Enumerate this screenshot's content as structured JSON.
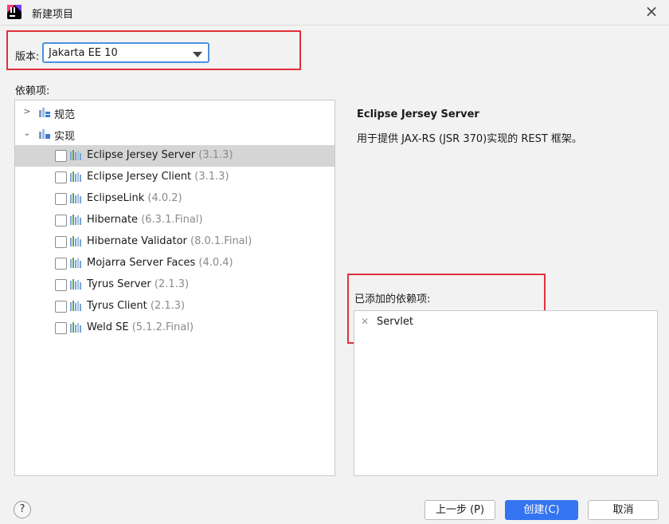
{
  "window": {
    "title": "新建项目",
    "close_icon": "close-icon"
  },
  "version": {
    "label": "版本:",
    "selected": "Jakarta EE 10"
  },
  "dependencies": {
    "label": "依赖项:",
    "categories": [
      {
        "label": "规范",
        "expanded": false
      },
      {
        "label": "实现",
        "expanded": true
      }
    ],
    "libraries": [
      {
        "name": "Eclipse Jersey Server",
        "version": "(3.1.3)",
        "checked": false,
        "selected": true
      },
      {
        "name": "Eclipse Jersey Client",
        "version": "(3.1.3)",
        "checked": false
      },
      {
        "name": "EclipseLink",
        "version": "(4.0.2)",
        "checked": false
      },
      {
        "name": "Hibernate",
        "version": "(6.3.1.Final)",
        "checked": false
      },
      {
        "name": "Hibernate Validator",
        "version": "(8.0.1.Final)",
        "checked": false
      },
      {
        "name": "Mojarra Server Faces",
        "version": "(4.0.4)",
        "checked": false
      },
      {
        "name": "Tyrus Server",
        "version": "(2.1.3)",
        "checked": false
      },
      {
        "name": "Tyrus Client",
        "version": "(2.1.3)",
        "checked": false
      },
      {
        "name": "Weld SE",
        "version": "(5.1.2.Final)",
        "checked": false
      }
    ]
  },
  "description": {
    "title": "Eclipse Jersey Server",
    "text": "用于提供 JAX-RS (JSR 370)实现的 REST 框架。"
  },
  "added": {
    "label": "已添加的依赖项:",
    "items": [
      {
        "name": "Servlet",
        "remove_icon": "remove-icon"
      }
    ]
  },
  "footer": {
    "help": "?",
    "prev": "上一步 (P)",
    "create": "创建(C)",
    "cancel": "取消"
  },
  "colors": {
    "accent": "#3574f0",
    "annotation": "#e0313a",
    "selected_row": "#d5d5d5"
  }
}
